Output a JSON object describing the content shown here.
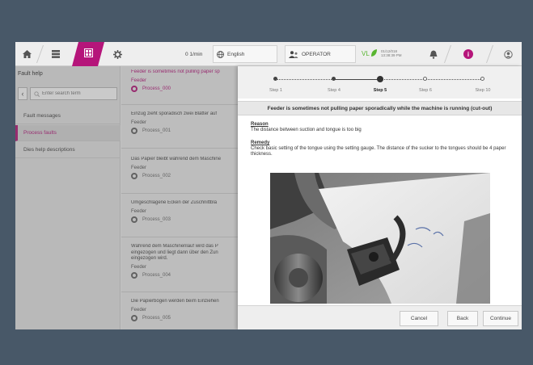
{
  "topbar": {
    "speed": "0 1/min",
    "language": "English",
    "role": "OPERATOR",
    "clock_date": "01/12/018",
    "clock_time": "13:38:39 PM",
    "icons": [
      "home-icon",
      "list-icon",
      "help-grid-icon",
      "gear-icon",
      "globe-icon",
      "operator-icon",
      "leaf-icon",
      "bell-icon",
      "info-icon",
      "user-icon"
    ]
  },
  "leftpanel": {
    "title": "Fault help",
    "search_placeholder": "Enter search term",
    "items": [
      {
        "label": "Fault messages"
      },
      {
        "label": "Process faults"
      },
      {
        "label": "Dies help descriptions"
      }
    ]
  },
  "midlist": {
    "items": [
      {
        "title": "Feeder is sometimes not pulling paper sp",
        "feeder": "Feeder",
        "process": "Process_000"
      },
      {
        "title": "Einzug zieht sporadisch zwei Blätter auf",
        "feeder": "Feeder",
        "process": "Process_001"
      },
      {
        "title": "Das Papier bleibt während dem Maschine",
        "feeder": "Feeder",
        "process": "Process_002"
      },
      {
        "title": "Umgeschlagene Ecken der Zuschnittblä",
        "feeder": "Feeder",
        "process": "Process_003"
      },
      {
        "title": "Während dem Maschinenlauf wird das P eingezogen und liegt dann über den Zun eingezogen wird.",
        "feeder": "Feeder",
        "process": "Process_004"
      },
      {
        "title": "Die Papierbögen werden beim Einziehen",
        "feeder": "Feeder",
        "process": "Process_005"
      }
    ]
  },
  "dialog": {
    "steps": [
      {
        "label": "Step 1"
      },
      {
        "label": "Step 4"
      },
      {
        "label": "Step 5"
      },
      {
        "label": "Step 6"
      },
      {
        "label": "Step 10"
      }
    ],
    "heading": "Feeder is sometimes not pulling paper sporadically while the machine is running (cut-out)",
    "reason_label": "Reason",
    "reason_text": "The distance between suction and tongue is too big",
    "remedy_label": "Remedy",
    "remedy_text": "Check basic setting of the tongue using the setting gauge. The distance of the sucker to the tongues should be 4 paper thickness.",
    "buttons": {
      "cancel": "Cancel",
      "back": "Back",
      "continue": "Continue"
    }
  },
  "colors": {
    "accent": "#b5157a",
    "frame": "#485868"
  }
}
